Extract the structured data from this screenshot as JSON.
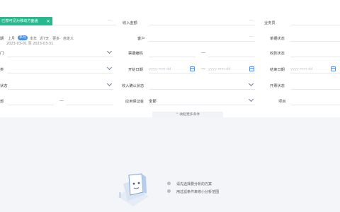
{
  "toast": {
    "text": "已按可见为移动方面盖",
    "close": "×"
  },
  "quick_filters": {
    "label_prefix": "期",
    "items": [
      "上月",
      "本月",
      "本年",
      "近7天",
      "更多",
      "自定义"
    ],
    "active_index": 1,
    "range": "2023-03-01 至 2023-03-31"
  },
  "col1_labels": [
    "门",
    "类",
    "状态",
    "部"
  ],
  "col2": {
    "labels": [
      "收入金额",
      "客户",
      "票据编码",
      "开始日期",
      "收入确认状态",
      "应用保证金"
    ],
    "date_placeholder": "yyyy-mm-dd",
    "deposit_value": "全部"
  },
  "col3": {
    "labels": [
      "业务员",
      "单据状态",
      "收款状态",
      "结束日期",
      "开票状态",
      "项目"
    ],
    "date_placeholder": "yyyy-mm-dd"
  },
  "collapse_button": "收起更多条件",
  "empty_hints": [
    "请先选择要分析的方案",
    "用过滤条件来修小分析范围"
  ],
  "colors": {
    "accent": "#4a8ee0",
    "toast": "#27b88f",
    "background": "#f3f5f8"
  }
}
